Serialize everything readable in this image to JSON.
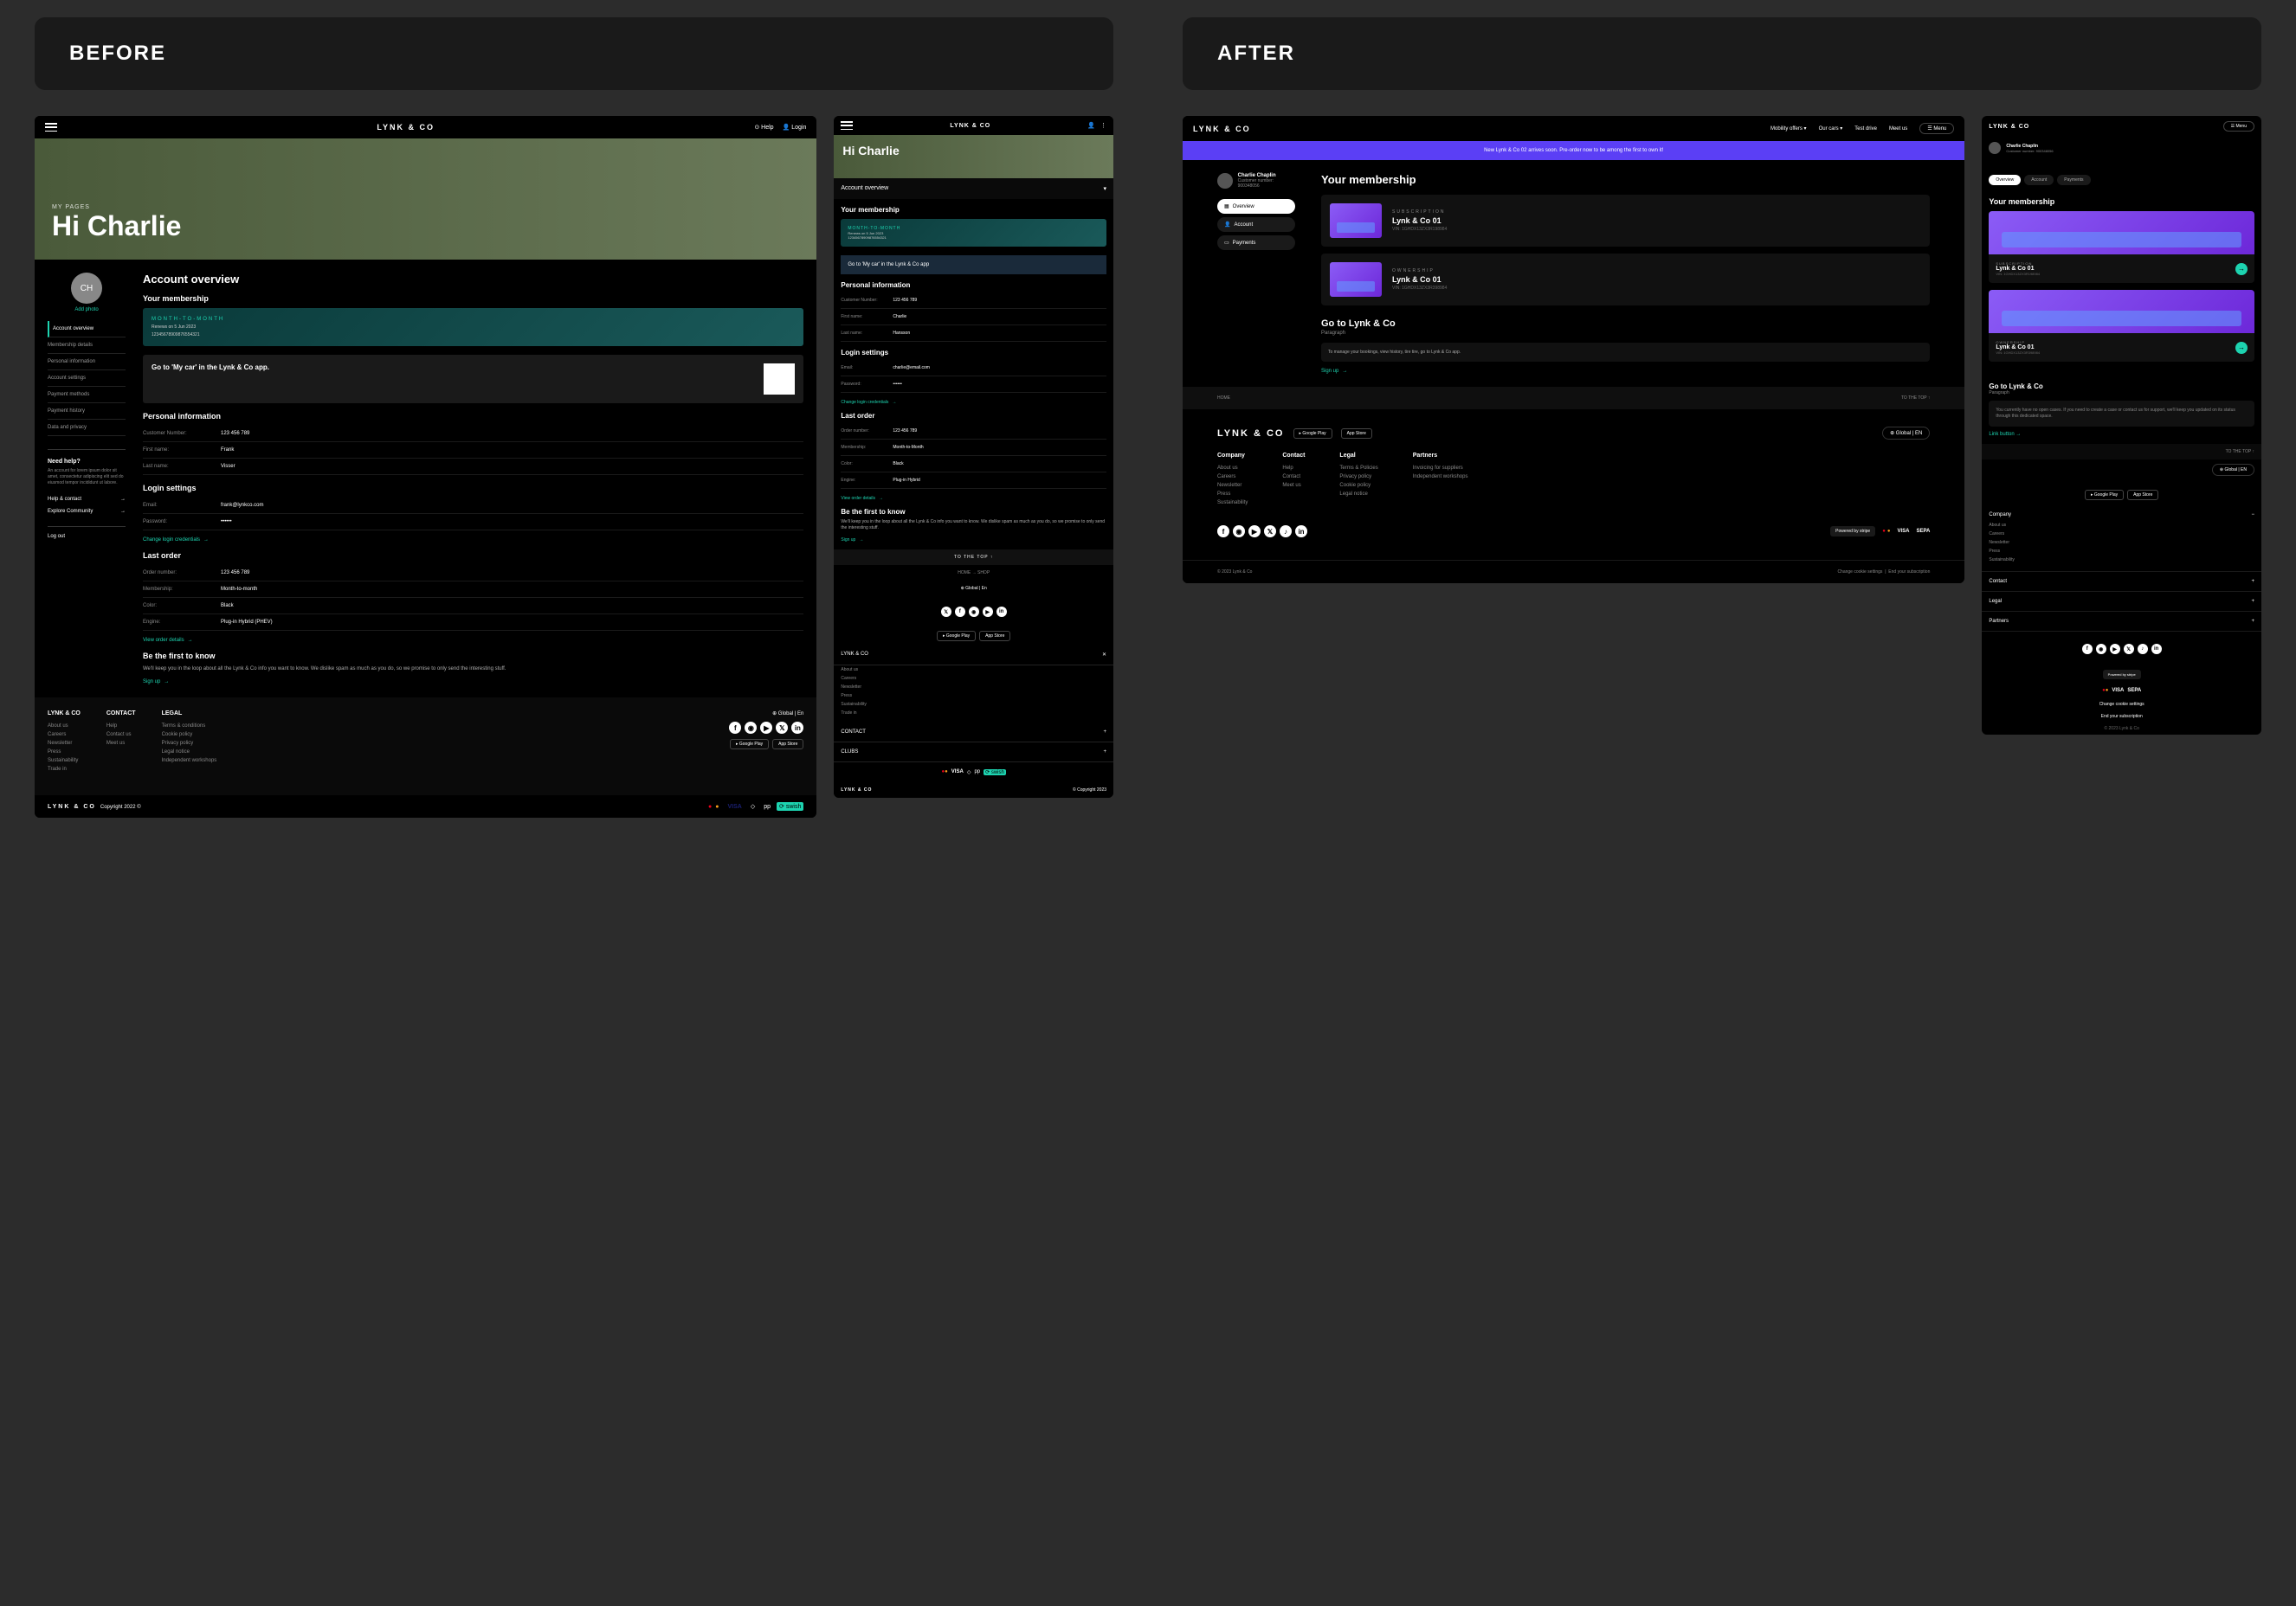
{
  "labels": {
    "before": "BEFORE",
    "after": "AFTER"
  },
  "brand": "LYNK & CO",
  "before": {
    "topbar": {
      "help": "Help",
      "login": "Login"
    },
    "hero": {
      "tag": "MY PAGES",
      "title": "Hi Charlie"
    },
    "sidebar": {
      "avatar_initials": "CH",
      "add_photo": "Add photo",
      "nav": [
        "Account overview",
        "Membership details",
        "Personal information",
        "Account settings",
        "Payment methods",
        "Payment history",
        "Data and privacy"
      ],
      "help_title": "Need help?",
      "help_text": "An account for lorem ipsum dolor sit amet, consectetur adipiscing elit sed do eiusmod tempor incididunt ut labore.",
      "help_contact": "Help & contact",
      "explore": "Explore Community",
      "logout": "Log out"
    },
    "main": {
      "overview_title": "Account overview",
      "membership_title": "Your membership",
      "membership_card": {
        "label": "MONTH-TO-MONTH",
        "renews": "Renews on 5 Jun 2023",
        "id": "12345678909876554321"
      },
      "app_card": "Go to 'My car' in the Lynk & Co app.",
      "personal_title": "Personal information",
      "personal": [
        {
          "k": "Customer Number:",
          "v": "123 456 789"
        },
        {
          "k": "First name:",
          "v": "Frank"
        },
        {
          "k": "Last name:",
          "v": "Visser"
        }
      ],
      "login_title": "Login settings",
      "login": [
        {
          "k": "Email:",
          "v": "frank@lynkco.com"
        },
        {
          "k": "Password:",
          "v": "••••••"
        }
      ],
      "change_credentials": "Change login credentials",
      "order_title": "Last order",
      "order": [
        {
          "k": "Order number:",
          "v": "123 456 789"
        },
        {
          "k": "Membership:",
          "v": "Month-to-month"
        },
        {
          "k": "Color:",
          "v": "Black"
        },
        {
          "k": "Engine:",
          "v": "Plug-in Hybrid (PHEV)"
        }
      ],
      "view_order": "View order details",
      "news_title": "Be the first to know",
      "news_text": "We'll keep you in the loop about all the Lynk & Co info you want to know. We dislike spam as much as you do, so we promise to only send the interesting stuff.",
      "signup": "Sign up"
    },
    "footer": {
      "globe": "Global | En",
      "cols": [
        {
          "h": "LYNK & CO",
          "items": [
            "About us",
            "Careers",
            "Newsletter",
            "Press",
            "Sustainability",
            "Trade in"
          ]
        },
        {
          "h": "CONTACT",
          "items": [
            "Help",
            "Contact us",
            "Meet us"
          ]
        },
        {
          "h": "LEGAL",
          "items": [
            "Terms & conditions",
            "Cookie policy",
            "Privacy policy",
            "Legal notice",
            "Independent workshops"
          ]
        }
      ],
      "copyright": "Copyright 2022 ©",
      "payments": [
        "mc",
        "VISA",
        "dc",
        "pp",
        "swish"
      ]
    },
    "mobile": {
      "dropdown": "Account overview",
      "membership_title": "Your membership",
      "app_text": "Go to 'My car' in the Lynk & Co app",
      "personal_title": "Personal information",
      "login_title": "Login settings",
      "email": "charlie@email.com",
      "order_title": "Last order",
      "order": [
        {
          "k": "Order number:",
          "v": "123 456 789"
        },
        {
          "k": "Membership:",
          "v": "Month-to-Month"
        },
        {
          "k": "Color:",
          "v": "Black"
        },
        {
          "k": "Engine:",
          "v": "Plug-in Hybrid"
        }
      ],
      "view_order": "View order details",
      "news_title": "Be the first to know",
      "news_text": "We'll keep you in the loop about all the Lynk & Co info you want to know. We dislike spam as much as you do, so we promise to only send the interesting stuff.",
      "to_top": "TO THE TOP",
      "crumbs": "HOME → SHOP",
      "globe": "Global | En",
      "accordion": [
        "LYNK & CO",
        "CONTACT",
        "CLUBS"
      ],
      "acc_items": [
        "About us",
        "Careers",
        "Newsletter",
        "Press",
        "Sustainability",
        "Trade in"
      ],
      "copyright": "© Copyright 2023"
    }
  },
  "after": {
    "topnav": [
      "Mobility offers",
      "Our cars",
      "Test drive",
      "Meet us"
    ],
    "menu": "Menu",
    "banner": "New Lynk & Co 02 arrives soon. Pre-order now to be among the first to own it!",
    "user": {
      "name": "Charlie Chaplin",
      "sub": "Customer number: 900348056"
    },
    "nav": [
      {
        "icon": "▦",
        "label": "Overview"
      },
      {
        "icon": "👤",
        "label": "Account"
      },
      {
        "icon": "▭",
        "label": "Payments"
      }
    ],
    "main": {
      "title": "Your membership",
      "cards": [
        {
          "tag": "SUBSCRIPTION",
          "model": "Lynk & Co 01",
          "vin": "VIN: 1GHDX13ZX3R198984"
        },
        {
          "tag": "OWNERSHIP",
          "model": "Lynk & Co 01",
          "vin": "VIN: 1GHDX13ZX3R398984"
        }
      ],
      "goto_title": "Go to Lynk & Co",
      "goto_sub": "Paragraph",
      "goto_box": "To manage your bookings, view history, tire tire, go to Lynk & Co app.",
      "signup": "Sign up"
    },
    "breadcrumb": {
      "left": "HOME",
      "right": "TO THE TOP ↑"
    },
    "footer": {
      "globe": "Global | EN",
      "cols": [
        {
          "h": "Company",
          "items": [
            "About us",
            "Careers",
            "Newsletter",
            "Press",
            "Sustainability"
          ]
        },
        {
          "h": "Contact",
          "items": [
            "Help",
            "Contact",
            "Meet us"
          ]
        },
        {
          "h": "Legal",
          "items": [
            "Terms & Policies",
            "Privacy policy",
            "Cookie policy",
            "Legal notice"
          ]
        },
        {
          "h": "Partners",
          "items": [
            "Invoicing for suppliers",
            "Independent workshops"
          ]
        }
      ],
      "stripe": "Powered by stripe",
      "pay": [
        "mc",
        "VISA",
        "SEPA"
      ],
      "copyright": "© 2023 Lynk & Co",
      "cookie": "Change cookie settings",
      "end_sub": "End your subscription"
    },
    "mobile": {
      "tabs": [
        "Overview",
        "Account",
        "Payments"
      ],
      "title": "Your membership",
      "goto_title": "Go to Lynk & Co",
      "goto_sub": "Paragraph",
      "note": "You currently have no open cases. If you need to create a case or contact us for support, we'll keep you updated on its status through this dedicated space.",
      "link_btn": "Link button",
      "to_top": "TO THE TOP ↑",
      "globe": "Global | EN",
      "accordion": [
        "Company",
        "Contact",
        "Legal",
        "Partners"
      ],
      "company_items": [
        "About us",
        "Careers",
        "Newsletter",
        "Press",
        "Sustainability"
      ],
      "cookie": "Change cookie settings",
      "end_sub": "End your subscription",
      "copyright": "© 2023 Lynk & Co"
    }
  }
}
